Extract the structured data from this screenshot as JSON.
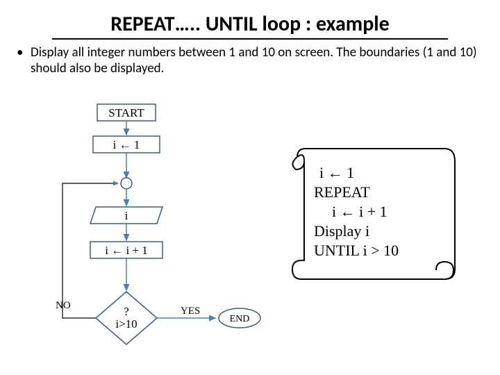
{
  "title": "REPEAT….. UNTIL loop : example",
  "description": "Display all integer numbers between 1 and 10 on screen. The boundaries (1 and 10) should also be displayed.",
  "flowchart": {
    "start": "START",
    "init": "i ← 1",
    "display": "i",
    "increment": "i ← i + 1",
    "decision_q": "?",
    "decision_cond": "i>10",
    "no": "NO",
    "yes": "YES",
    "end": "END"
  },
  "pseudocode": {
    "line1": "i ← 1",
    "line2": "REPEAT",
    "line3": "i ← i + 1",
    "line4": "Display i",
    "line5": "UNTIL i > 10"
  }
}
